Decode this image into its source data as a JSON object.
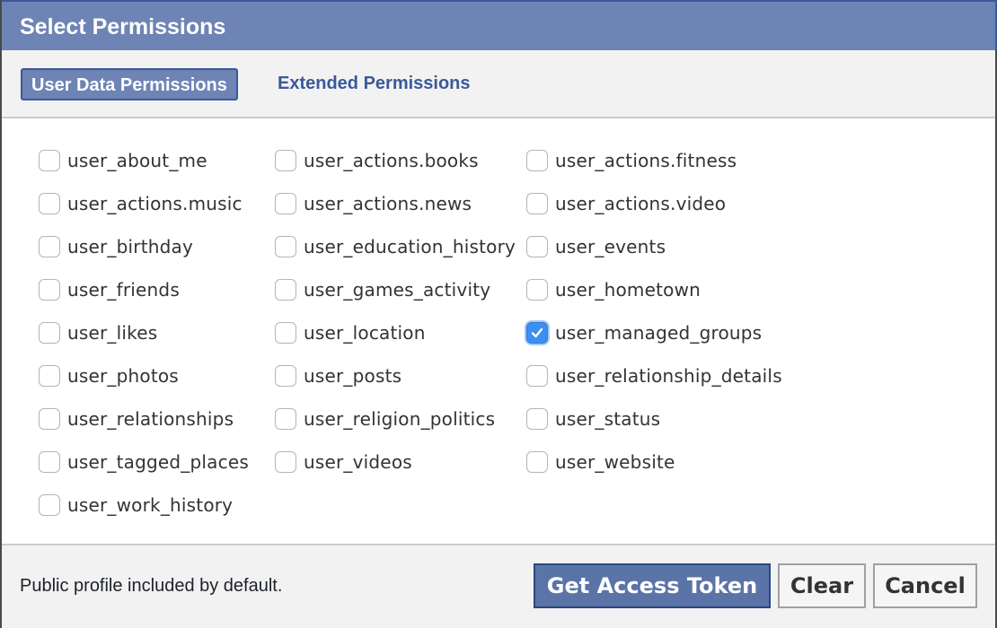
{
  "dialog": {
    "title": "Select Permissions"
  },
  "tabs": [
    {
      "label": "User Data Permissions",
      "active": true
    },
    {
      "label": "Extended Permissions",
      "active": false
    }
  ],
  "permissions": {
    "columns": [
      [
        {
          "label": "user_about_me",
          "checked": false
        },
        {
          "label": "user_actions.music",
          "checked": false
        },
        {
          "label": "user_birthday",
          "checked": false
        },
        {
          "label": "user_friends",
          "checked": false
        },
        {
          "label": "user_likes",
          "checked": false
        },
        {
          "label": "user_photos",
          "checked": false
        },
        {
          "label": "user_relationships",
          "checked": false
        },
        {
          "label": "user_tagged_places",
          "checked": false
        },
        {
          "label": "user_work_history",
          "checked": false
        }
      ],
      [
        {
          "label": "user_actions.books",
          "checked": false
        },
        {
          "label": "user_actions.news",
          "checked": false
        },
        {
          "label": "user_education_history",
          "checked": false
        },
        {
          "label": "user_games_activity",
          "checked": false
        },
        {
          "label": "user_location",
          "checked": false
        },
        {
          "label": "user_posts",
          "checked": false
        },
        {
          "label": "user_religion_politics",
          "checked": false
        },
        {
          "label": "user_videos",
          "checked": false
        }
      ],
      [
        {
          "label": "user_actions.fitness",
          "checked": false
        },
        {
          "label": "user_actions.video",
          "checked": false
        },
        {
          "label": "user_events",
          "checked": false
        },
        {
          "label": "user_hometown",
          "checked": false
        },
        {
          "label": "user_managed_groups",
          "checked": true
        },
        {
          "label": "user_relationship_details",
          "checked": false
        },
        {
          "label": "user_status",
          "checked": false
        },
        {
          "label": "user_website",
          "checked": false
        }
      ]
    ]
  },
  "footer": {
    "note": "Public profile included by default.",
    "get_token_label": "Get Access Token",
    "clear_label": "Clear",
    "cancel_label": "Cancel"
  },
  "colors": {
    "header_bg": "#6d84b4",
    "brand_blue": "#3b5998",
    "checkbox_checked": "#3b8ff0"
  }
}
